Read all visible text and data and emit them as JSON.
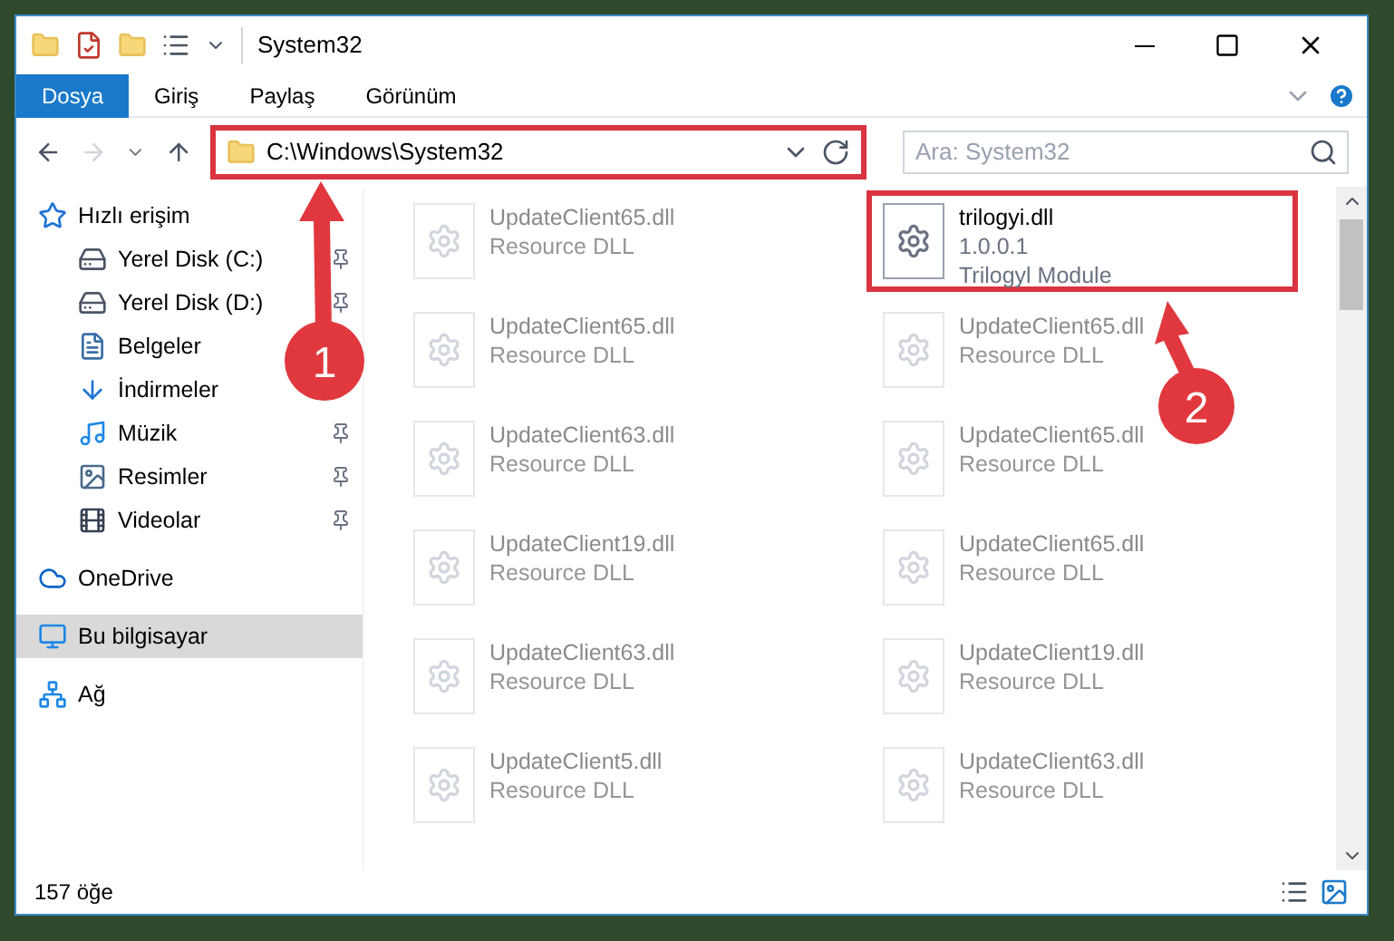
{
  "window": {
    "title": "System32"
  },
  "ribbon_tabs": [
    {
      "label": "Dosya",
      "selected": true
    },
    {
      "label": "Giriş",
      "selected": false
    },
    {
      "label": "Paylaş",
      "selected": false
    },
    {
      "label": "Görünüm",
      "selected": false
    }
  ],
  "address": {
    "path": "C:\\Windows\\System32",
    "highlighted": true
  },
  "search": {
    "placeholder": "Ara: System32"
  },
  "sidebar": {
    "items": [
      {
        "label": "Hızlı erişim",
        "kind": "quick",
        "selected": false,
        "children": [
          {
            "label": "Yerel Disk (C:)",
            "kind": "disk-c",
            "pinned": true
          },
          {
            "label": "Yerel Disk (D:)",
            "kind": "disk",
            "pinned": true
          },
          {
            "label": "Belgeler",
            "kind": "docs",
            "pinned": false
          },
          {
            "label": "İndirmeler",
            "kind": "downloads",
            "pinned": false
          },
          {
            "label": "Müzik",
            "kind": "music",
            "pinned": true
          },
          {
            "label": "Resimler",
            "kind": "pictures",
            "pinned": true
          },
          {
            "label": "Videolar",
            "kind": "videos",
            "pinned": true
          }
        ]
      },
      {
        "label": "OneDrive",
        "kind": "cloud",
        "selected": false
      },
      {
        "label": "Bu bilgisayar",
        "kind": "pc",
        "selected": true
      },
      {
        "label": "Ağ",
        "kind": "network",
        "selected": false
      }
    ]
  },
  "files": [
    {
      "name": "UpdateClient65.dll",
      "line2": "Resource DLL",
      "faded": true,
      "highlighted": false
    },
    {
      "name": "trilogyi.dll",
      "line2": "1.0.0.1",
      "line3": "Trilogyl Module",
      "faded": false,
      "highlighted": true
    },
    {
      "name": "UpdateClient65.dll",
      "line2": "Resource DLL",
      "faded": true,
      "highlighted": false
    },
    {
      "name": "UpdateClient65.dll",
      "line2": "Resource DLL",
      "faded": true,
      "highlighted": false
    },
    {
      "name": "UpdateClient63.dll",
      "line2": "Resource DLL",
      "faded": true,
      "highlighted": false
    },
    {
      "name": "UpdateClient65.dll",
      "line2": "Resource DLL",
      "faded": true,
      "highlighted": false
    },
    {
      "name": "UpdateClient19.dll",
      "line2": "Resource DLL",
      "faded": true,
      "highlighted": false
    },
    {
      "name": "UpdateClient65.dll",
      "line2": "Resource DLL",
      "faded": true,
      "highlighted": false
    },
    {
      "name": "UpdateClient63.dll",
      "line2": "Resource DLL",
      "faded": true,
      "highlighted": false
    },
    {
      "name": "UpdateClient19.dll",
      "line2": "Resource DLL",
      "faded": true,
      "highlighted": false
    },
    {
      "name": "UpdateClient5.dll",
      "line2": "Resource DLL",
      "faded": true,
      "highlighted": false
    },
    {
      "name": "UpdateClient63.dll",
      "line2": "Resource DLL",
      "faded": true,
      "highlighted": false
    }
  ],
  "status_bar": {
    "count": "157 öğe"
  },
  "annotations": [
    {
      "label": "1",
      "kind": "up"
    },
    {
      "label": "2",
      "kind": "diagonal"
    }
  ]
}
